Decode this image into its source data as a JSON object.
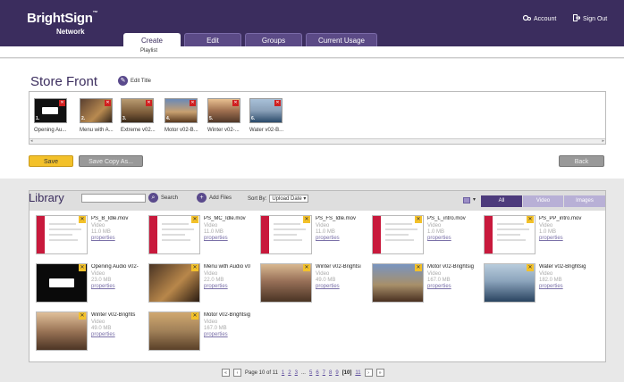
{
  "header": {
    "logo_main": "BrightSign",
    "logo_tm": "™",
    "logo_sub": "Network",
    "account_label": "Account",
    "signout_label": "Sign Out",
    "tabs": [
      {
        "label": "Create",
        "active": true
      },
      {
        "label": "Edit",
        "active": false
      },
      {
        "label": "Groups",
        "active": false
      },
      {
        "label": "Current Usage",
        "active": false
      }
    ],
    "subtab": "Playlist"
  },
  "storefront": {
    "title": "Store Front",
    "edit_title": "Edit Title",
    "items": [
      {
        "num": "1.",
        "label": "Opening Au..."
      },
      {
        "num": "2.",
        "label": "Menu with A..."
      },
      {
        "num": "3.",
        "label": "Extreme v02..."
      },
      {
        "num": "4.",
        "label": "Motor v02-B..."
      },
      {
        "num": "5.",
        "label": "Winter v02-..."
      },
      {
        "num": "6.",
        "label": "Water v02-B..."
      }
    ],
    "save": "Save",
    "save_copy": "Save Copy As...",
    "back": "Back"
  },
  "library": {
    "title": "Library",
    "search": "Search",
    "add_files": "Add Files",
    "sort_by": "Sort By:",
    "sort_value": "Upload Date",
    "filters": [
      {
        "label": "All",
        "active": true
      },
      {
        "label": "Video",
        "active": false
      },
      {
        "label": "Images",
        "active": false
      }
    ],
    "items": [
      {
        "name": "PS_B_Idle.mov",
        "type": "Video",
        "size": "11.0 MB",
        "link": "properties",
        "kind": "doc"
      },
      {
        "name": "PS_MC_Idle.mov",
        "type": "Video",
        "size": "11.0 MB",
        "link": "properties",
        "kind": "doc"
      },
      {
        "name": "PS_FS_Idle.mov",
        "type": "Video",
        "size": "11.0 MB",
        "link": "properties",
        "kind": "doc"
      },
      {
        "name": "PS_L_intro.mov",
        "type": "Video",
        "size": "1.0 MB",
        "link": "properties",
        "kind": "doc"
      },
      {
        "name": "PS_PP_intro.mov",
        "type": "Video",
        "size": "1.0 MB",
        "link": "properties",
        "kind": "doc"
      },
      {
        "name": "Opening Audio v02-",
        "type": "Video",
        "size": "23.0 MB",
        "link": "properties",
        "kind": "gopro"
      },
      {
        "name": "Menu with Audio v0",
        "type": "Video",
        "size": "22.0 MB",
        "link": "properties",
        "kind": "menu"
      },
      {
        "name": "Winter v02-Brightsi",
        "type": "Video",
        "size": "49.0 MB",
        "link": "properties",
        "kind": "winter"
      },
      {
        "name": "Motor v02-Brightsig",
        "type": "Video",
        "size": "167.0 MB",
        "link": "properties",
        "kind": "motor"
      },
      {
        "name": "Water v02-Brightsig",
        "type": "Video",
        "size": "182.0 MB",
        "link": "properties",
        "kind": "water"
      },
      {
        "name": "Winter v02-Brights",
        "type": "Video",
        "size": "49.0 MB",
        "link": "properties",
        "kind": "winter2"
      },
      {
        "name": "Motor v02-Brightsig",
        "type": "Video",
        "size": "167.0 MB",
        "link": "properties",
        "kind": "motor2"
      }
    ],
    "pager": {
      "label": "Page 10 of 11",
      "pages": [
        "1",
        "2",
        "3",
        "...",
        "5",
        "6",
        "7",
        "8",
        "9",
        "[10]",
        "11"
      ]
    }
  }
}
